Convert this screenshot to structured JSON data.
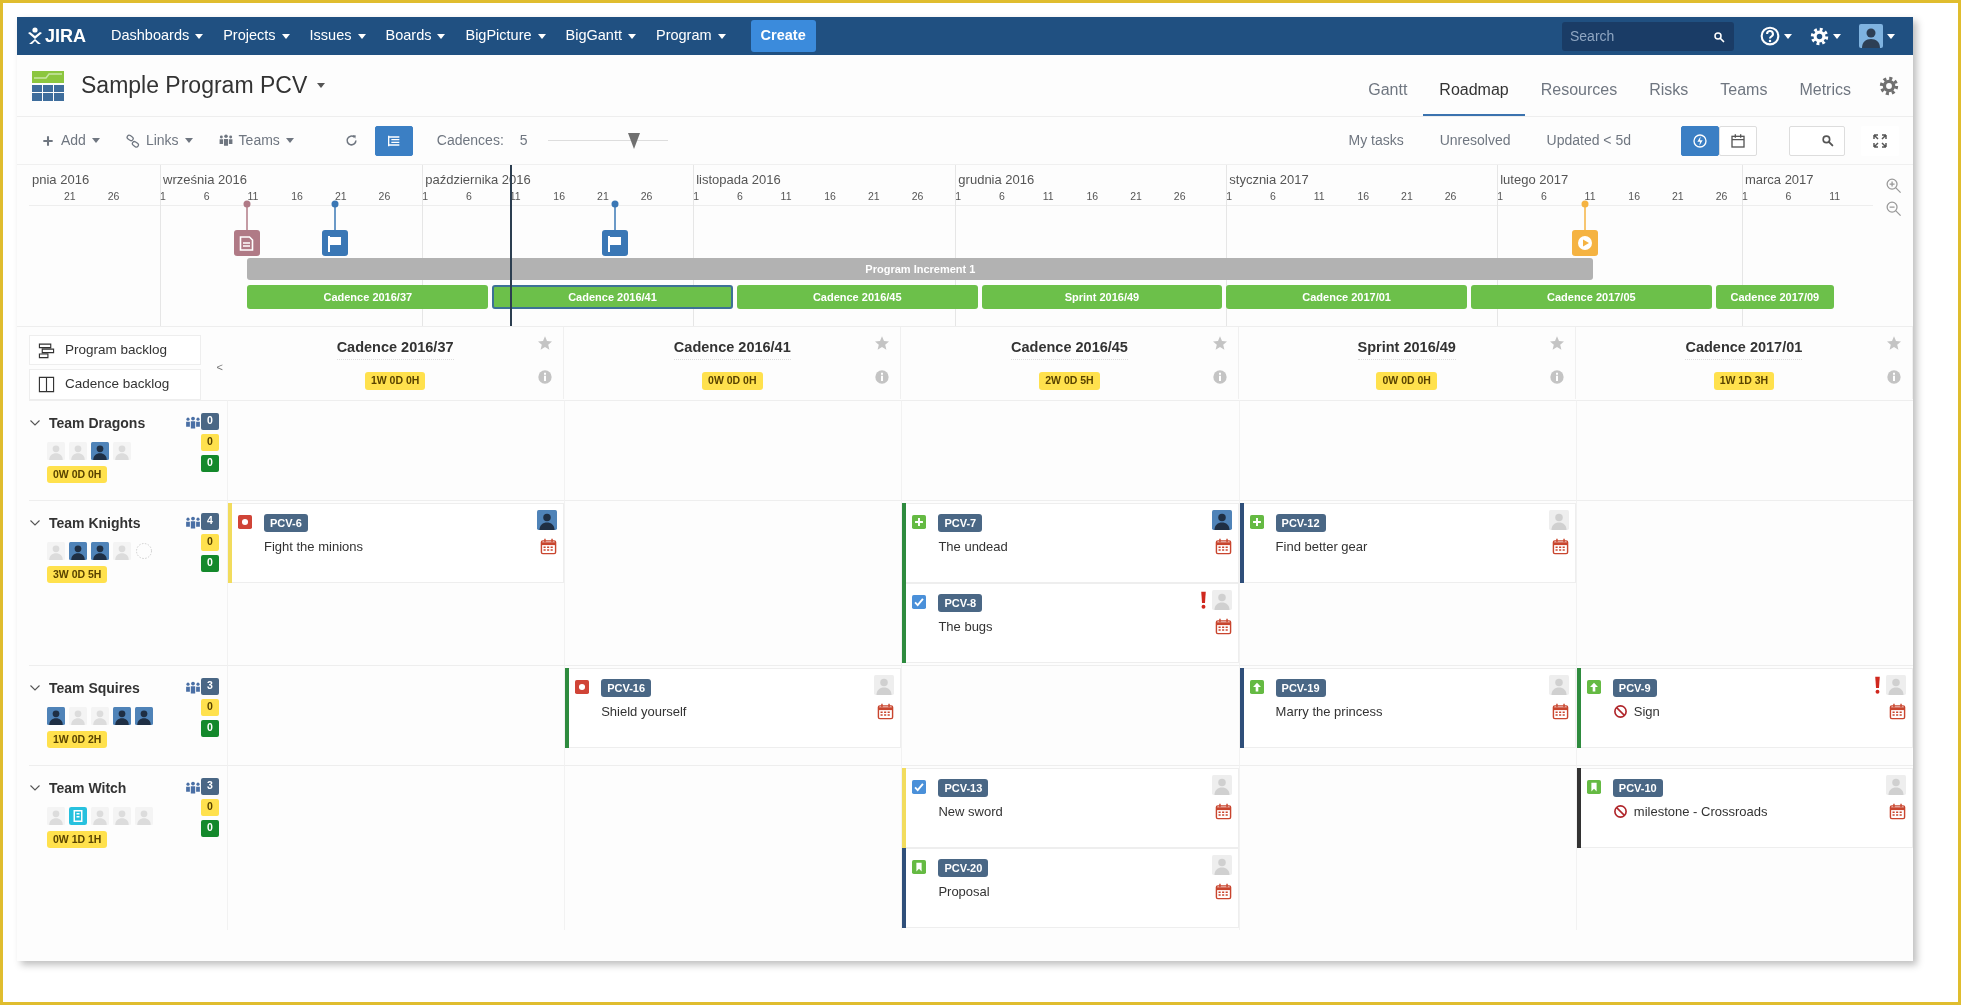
{
  "navbar": {
    "logo": "JIRA",
    "menus": [
      "Dashboards",
      "Projects",
      "Issues",
      "Boards",
      "BigPicture",
      "BigGantt",
      "Program"
    ],
    "create": "Create",
    "search": {
      "placeholder": "Search"
    }
  },
  "project": {
    "title": "Sample Program PCV"
  },
  "tabs": [
    {
      "label": "Gantt",
      "selected": false
    },
    {
      "label": "Roadmap",
      "selected": true
    },
    {
      "label": "Resources",
      "selected": false
    },
    {
      "label": "Risks",
      "selected": false
    },
    {
      "label": "Teams",
      "selected": false
    },
    {
      "label": "Metrics",
      "selected": false
    }
  ],
  "toolbar": {
    "menus": [
      {
        "kind": "add",
        "label": "Add"
      },
      {
        "kind": "links",
        "label": "Links"
      },
      {
        "kind": "teams",
        "label": "Teams"
      }
    ],
    "tree_view": {
      "on": true
    },
    "cadences": {
      "label": "Cadences:",
      "value": "5",
      "level": 0.72
    },
    "filters": [
      "My tasks",
      "Unresolved",
      "Updated < 5d"
    ],
    "view_buttons": [
      {
        "kind": "lightning",
        "on": true
      },
      {
        "kind": "calendar",
        "on": false
      }
    ]
  },
  "timeline": {
    "months": [
      {
        "label": "pnia 2016",
        "days": [
          "21",
          "26"
        ]
      },
      {
        "label": "września 2016",
        "days": [
          "1",
          "6",
          "11",
          "16",
          "21",
          "26"
        ]
      },
      {
        "label": "października 2016",
        "days": [
          "1",
          "6",
          "11",
          "16",
          "21",
          "26"
        ]
      },
      {
        "label": "listopada 2016",
        "days": [
          "1",
          "6",
          "11",
          "16",
          "21",
          "26"
        ]
      },
      {
        "label": "grudnia 2016",
        "days": [
          "1",
          "6",
          "11",
          "16",
          "21",
          "26"
        ]
      },
      {
        "label": "stycznia 2017",
        "days": [
          "1",
          "6",
          "11",
          "16",
          "21",
          "26"
        ]
      },
      {
        "label": "lutego 2017",
        "days": [
          "1",
          "6",
          "11",
          "16",
          "21",
          "26"
        ]
      },
      {
        "label": "marca 2017",
        "days": [
          "1",
          "6",
          "11"
        ]
      }
    ],
    "milestones": [
      {
        "kind": "document"
      },
      {
        "kind": "flag"
      },
      {
        "kind": "flag"
      },
      {
        "kind": "play"
      }
    ],
    "increment": {
      "label": "Program Increment 1"
    },
    "cadences": [
      {
        "label": "Cadence 2016/37",
        "selected": false
      },
      {
        "label": "Cadence 2016/41",
        "selected": true
      },
      {
        "label": "Cadence 2016/45",
        "selected": false
      },
      {
        "label": "Sprint 2016/49",
        "selected": false
      },
      {
        "label": "Cadence 2017/01",
        "selected": false
      },
      {
        "label": "Cadence 2017/05",
        "selected": false
      },
      {
        "label": "Cadence 2017/09",
        "selected": false
      }
    ]
  },
  "backlog_buttons": [
    {
      "kind": "program",
      "label": "Program backlog"
    },
    {
      "kind": "cadence",
      "label": "Cadence backlog"
    }
  ],
  "collapse": "<",
  "columns": [
    {
      "name": "Cadence 2016/37",
      "time": "1W 0D 0H"
    },
    {
      "name": "Cadence 2016/41",
      "time": "0W 0D 0H"
    },
    {
      "name": "Cadence 2016/45",
      "time": "2W 0D 5H"
    },
    {
      "name": "Sprint 2016/49",
      "time": "0W 0D 0H"
    },
    {
      "name": "Cadence 2017/01",
      "time": "1W 1D 3H"
    }
  ],
  "teams": [
    {
      "name": "Team Dragons",
      "expanded": true,
      "count": "0",
      "pending": "0",
      "done": "0",
      "time": "0W 0D 0H",
      "members": [
        {
          "kind": "blank"
        },
        {
          "kind": "blank"
        },
        {
          "kind": "person"
        },
        {
          "kind": "blank"
        }
      ],
      "cells": [
        [],
        [],
        [],
        [],
        []
      ]
    },
    {
      "name": "Team Knights",
      "expanded": true,
      "count": "4",
      "pending": "0",
      "done": "0",
      "time": "3W 0D 5H",
      "members": [
        {
          "kind": "blank"
        },
        {
          "kind": "person"
        },
        {
          "kind": "person"
        },
        {
          "kind": "blank"
        },
        {
          "kind": "vacant"
        }
      ],
      "cells": [
        [
          {
            "key": "PCV-6",
            "kind": "bug",
            "summary": "Fight the minions",
            "color": "#f2dc5d",
            "avatar": {
              "kind": "person"
            },
            "blocked": false,
            "priority": false
          }
        ],
        [],
        [
          {
            "key": "PCV-7",
            "kind": "new-feature",
            "summary": "The undead",
            "color": "#2e8b3e",
            "avatar": {
              "kind": "person"
            },
            "blocked": false,
            "priority": false
          },
          {
            "key": "PCV-8",
            "kind": "task",
            "summary": "The bugs",
            "color": "#2e8b3e",
            "avatar": {
              "kind": "blank"
            },
            "blocked": false,
            "priority": true
          }
        ],
        [
          {
            "key": "PCV-12",
            "kind": "new-feature",
            "summary": "Find better gear",
            "color": "#2f4f7a",
            "avatar": {
              "kind": "blank"
            },
            "blocked": false,
            "priority": false
          }
        ],
        []
      ]
    },
    {
      "name": "Team Squires",
      "expanded": true,
      "count": "3",
      "pending": "0",
      "done": "0",
      "time": "1W 0D 2H",
      "members": [
        {
          "kind": "person"
        },
        {
          "kind": "blank"
        },
        {
          "kind": "blank"
        },
        {
          "kind": "person"
        },
        {
          "kind": "person"
        }
      ],
      "cells": [
        [],
        [
          {
            "key": "PCV-16",
            "kind": "bug",
            "summary": "Shield yourself",
            "color": "#2e8b3e",
            "avatar": {
              "kind": "blank"
            },
            "blocked": false,
            "priority": false
          }
        ],
        [],
        [
          {
            "key": "PCV-19",
            "kind": "improvement",
            "summary": "Marry the princess",
            "color": "#2f4f7a",
            "avatar": {
              "kind": "blank"
            },
            "blocked": false,
            "priority": false
          }
        ],
        [
          {
            "key": "PCV-9",
            "kind": "improvement",
            "summary": "Sign",
            "color": "#2e8b3e",
            "avatar": {
              "kind": "blank"
            },
            "blocked": true,
            "priority": true
          }
        ]
      ]
    },
    {
      "name": "Team Witch",
      "expanded": true,
      "count": "3",
      "pending": "0",
      "done": "0",
      "time": "0W 1D 1H",
      "members": [
        {
          "kind": "blank"
        },
        {
          "kind": "robot"
        },
        {
          "kind": "blank"
        },
        {
          "kind": "blank"
        },
        {
          "kind": "blank"
        }
      ],
      "cells": [
        [],
        [],
        [
          {
            "key": "PCV-13",
            "kind": "task",
            "summary": "New sword",
            "color": "#f2dc5d",
            "avatar": {
              "kind": "blank"
            },
            "blocked": false,
            "priority": false
          },
          {
            "key": "PCV-20",
            "kind": "story",
            "summary": "Proposal",
            "color": "#2f4f7a",
            "avatar": {
              "kind": "blank"
            },
            "blocked": false,
            "priority": false
          }
        ],
        [],
        [
          {
            "key": "PCV-10",
            "kind": "story",
            "summary": "milestone - Crossroads",
            "color": "#333333",
            "avatar": {
              "kind": "blank"
            },
            "blocked": true,
            "priority": false
          }
        ]
      ]
    }
  ]
}
